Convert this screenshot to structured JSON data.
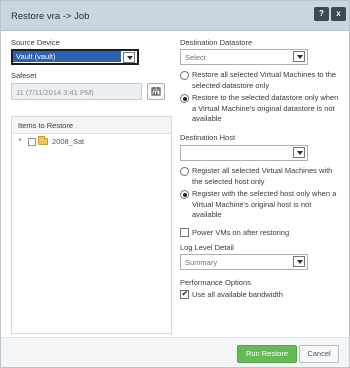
{
  "window": {
    "title": "Restore vra -> Job",
    "help_label": "?",
    "close_label": "x"
  },
  "source_device": {
    "label": "Source Device",
    "value": "Vault (vault)"
  },
  "safeset": {
    "label": "Safeset",
    "value": "11 (7/11/2014 3:41 PM)"
  },
  "items_to_restore": {
    "header": "Items to Restore",
    "items": [
      {
        "expander": "+",
        "label": "2008_Sat",
        "checked": false
      }
    ]
  },
  "destination_datastore": {
    "label": "Destination Datastore",
    "value": "Select",
    "options": [
      {
        "text_line1": "Restore all selected Virtual Machines to the",
        "text_line2": "selected datastore only",
        "text_line3": "",
        "selected": false
      },
      {
        "text_line1": "Restore to the selected datastore only when",
        "text_line2": "a Virtual Machine's original datastore is not",
        "text_line3": "available",
        "selected": true
      }
    ]
  },
  "destination_host": {
    "label": "Destination Host",
    "value": "",
    "options": [
      {
        "text_line1": "Register all selected Virtual Machines with",
        "text_line2": "the selected host only",
        "text_line3": "",
        "selected": false
      },
      {
        "text_line1": "Register with the selected host only when a",
        "text_line2": "Virtual Machine's original host is not",
        "text_line3": "available",
        "selected": true
      }
    ]
  },
  "power_on": {
    "label": "Power VMs on after restoring",
    "checked": false
  },
  "log_level": {
    "label": "Log Level Detail",
    "value": "Summary"
  },
  "performance": {
    "label": "Performance Options",
    "bandwidth_label": "Use all available bandwidth",
    "bandwidth_checked": true
  },
  "footer": {
    "run_label": "Run Restore",
    "cancel_label": "Cancel"
  },
  "colors": {
    "titlebar": "#c9d6df",
    "primary_button": "#66b956",
    "focus_highlight": "#2b62b0"
  }
}
